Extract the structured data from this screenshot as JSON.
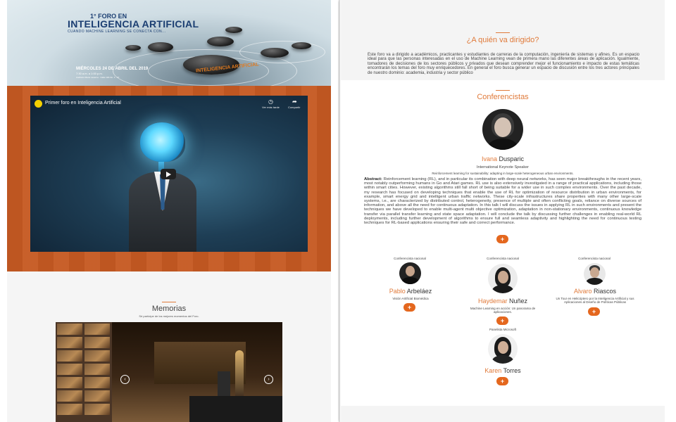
{
  "hero": {
    "edition": "1° FORO EN",
    "title": "INTELIGENCIA ARTIFICIAL",
    "tagline": "CUANDO MACHINE LEARNING SE CONECTA CON...",
    "date": "MIÉRCOLES 24 DE ABRIL DEL 2019",
    "time": "7:30 a.m. a 1:00 p.m.",
    "venue": "Auditorio Mario Laserna · Calle 19A No. 1 - 37",
    "stone_label": "INTELIGENCIA ARTIFICIAL"
  },
  "video": {
    "title": "Primer foro en Inteligencia Artificial",
    "watch_later": "Ver más tarde",
    "share": "Compartir"
  },
  "memories": {
    "title": "Memorias",
    "subtitle": "Sé partícipe de los mejores momentos del Foro."
  },
  "audience": {
    "title": "¿A quién va dirigido?",
    "text": "Este foro va a dirigido a académicos, practicantes y estudiantes de carreras de la computación, ingeniería de sistemas y afines. Es un espacio ideal para que las personas interesadas en el uso de Machine Learning vean de primera mano las diferentes áreas de aplicación. Igualmente, tomadores de decisiones de los sectores públicos y privados que desean comprender mejor el funcionamiento e impacto de estas temáticas encontrarán los temas del foro muy enriquecedores. En general el foro busca generar un espacio de discusión entre los tres actores principales de nuestro dominio: academia, industria y sector público"
  },
  "speakers": {
    "title": "Conferencistas",
    "keynote": {
      "first": "Ivana",
      "last": "Dusparic",
      "role": "International Keynote Speaker",
      "talk": "Reinforcement learning for sustainability: adapting in large-scale heterogeneous urban environments.",
      "abstract_label": "Abstract:",
      "abstract": "Reinforcement learning (RL), and in particular its combination with deep neural networks, has seen major breakthroughs in the recent years, most notably outperforming humans in Go and Atari games. RL use is also extensively investigated in a range of practical applications, including those within smart cities. However, existing algorithms still fall short of being suitable for a wider use in such complex environments. Over the past decade, my research has focused on developing techniques that enable the use of RL for optimization of resource distribution in urban environments, for example, smart energy grid and intelligent urban traffic networks. These city-scale infrastructures share properties with many other large-scale systems, i.e., are characterized by distributed control, heterogeneity, presence of multiple and often conflicting goals, reliance on diverse sources of information, and above all the need for continuous adaptation. In this talk I will discuss the issues in applying RL in such environments and present the techniques we have developed to enable multi-agent multi objective optimization, adaptation in non-stationary environments, continuous knowledge transfer via parallel transfer learning and state space adaptation. I will conclude the talk by discussing further challenges in enabling real-world RL deployments, including further development of algorithms to ensure full and seamless adaptivity and highlighting the need for continuous testing techniques for RL-based applications ensuring their safe and correct performance."
    },
    "plus_label": "+",
    "nationals": [
      {
        "role": "Conferencista nacional",
        "first": "Pablo",
        "last": "Arbeláez",
        "talk": "Visión Artificial Biomédica"
      },
      {
        "role": "Conferencista nacional",
        "first": "Haydemar",
        "last": "Nuñez",
        "talk": "Machine Learning en acción: Un panorama de aplicaciones."
      },
      {
        "role": "Conferencista nacional",
        "first": "Alvaro",
        "last": "Riascos",
        "talk": "Un Tour en Helicóptero por la Inteligencia Artificial y sus Aplicaciones al Diseño de Políticas Públicas"
      }
    ],
    "panelist": {
      "role": "Panelista Microsoft",
      "first": "Karen",
      "last": "Torres"
    }
  },
  "colors": {
    "accent": "#e07a3a",
    "band": "#c65a22",
    "button": "#e4671e",
    "title_blue": "#1b3e72"
  }
}
